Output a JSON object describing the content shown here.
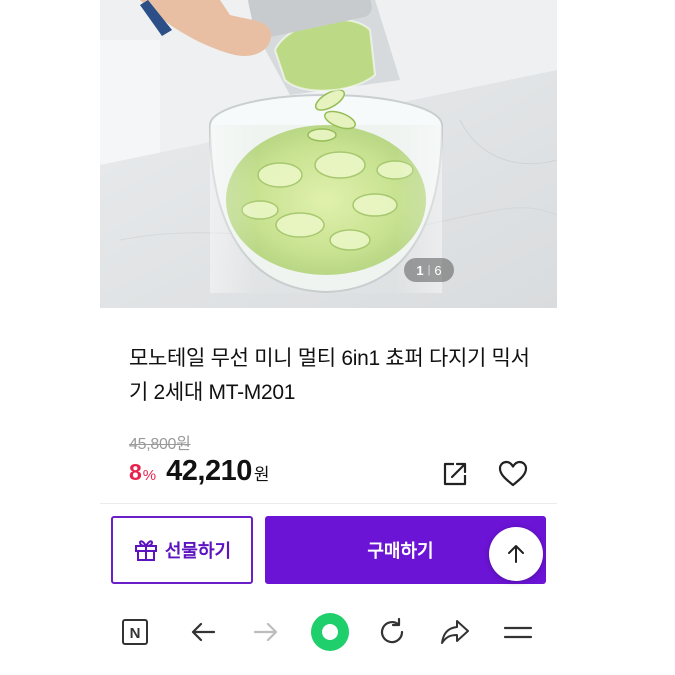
{
  "product": {
    "title": "모노테일 무선 미니 멀티 6in1 쵸퍼 다지기 믹서기 2세대 MT-M201",
    "original_price": "45,800원",
    "discount_value": "8",
    "discount_unit": "%",
    "sale_price": "42,210",
    "currency": "원"
  },
  "gallery": {
    "current": "1",
    "separator": "|",
    "total": "6"
  },
  "actions": {
    "gift_label": "선물하기",
    "buy_label": "구매하기",
    "share_icon": "share-icon",
    "wishlist_icon": "heart-icon",
    "scroll_top_icon": "arrow-up-icon"
  },
  "toolbar": {
    "icons": [
      "naver-home-icon",
      "back-arrow-icon",
      "forward-arrow-icon",
      "green-dot-icon",
      "refresh-icon",
      "share-arrow-icon",
      "menu-icon"
    ],
    "naver_letter": "N"
  },
  "colors": {
    "accent_purple": "#6b14d6",
    "discount_red": "#e8224f",
    "green_dot": "#1fcf6b"
  }
}
